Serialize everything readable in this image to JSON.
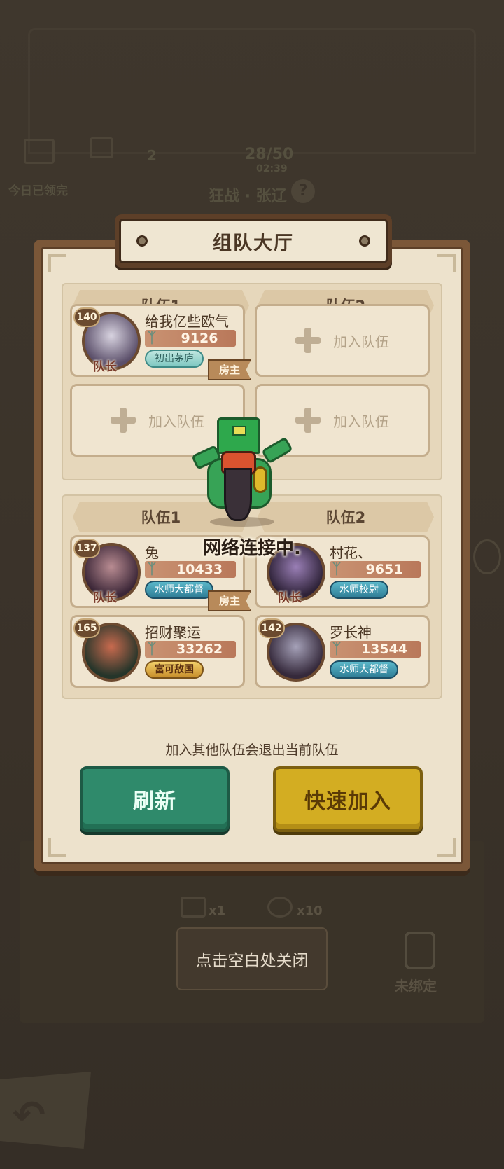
{
  "background": {
    "claimed_label": "今日已领完",
    "count_value": "2",
    "progress": "28/50",
    "timer": "02:39",
    "battle_label": "狂战 · 张辽",
    "help_icon": "question-icon",
    "item_counts": [
      "x1",
      "x10"
    ],
    "unbound_label": "未绑定"
  },
  "lobby": {
    "title": "组队大厅",
    "rooms": [
      {
        "teams": [
          {
            "header": "队伍1",
            "slots": [
              {
                "level": "140",
                "name": "给我亿些欧气",
                "power": "9126",
                "badge": "初出茅庐",
                "leader": "队长",
                "host": "房主"
              },
              {
                "empty_label": "加入队伍"
              }
            ]
          },
          {
            "header": "队伍2",
            "slots": [
              {
                "empty_label": "加入队伍"
              },
              {
                "empty_label": "加入队伍"
              }
            ]
          }
        ]
      },
      {
        "teams": [
          {
            "header": "队伍1",
            "slots": [
              {
                "level": "137",
                "name": "兔",
                "power": "10433",
                "badge": "水师大都督",
                "leader": "队长",
                "host": "房主"
              },
              {
                "level": "165",
                "name": "招财聚运",
                "power": "33262",
                "badge": "富可敌国"
              }
            ]
          },
          {
            "header": "队伍2",
            "slots": [
              {
                "level": "",
                "name": "村花、",
                "power": "9651",
                "badge": "水师校尉",
                "leader": "队长"
              },
              {
                "level": "142",
                "name": "罗长神",
                "power": "13544",
                "badge": "水师大都督"
              }
            ]
          }
        ]
      }
    ],
    "notice": "加入其他队伍会退出当前队伍",
    "refresh_label": "刷新",
    "quick_join_label": "快速加入"
  },
  "loading_text": "网络连接中.",
  "close_hint": "点击空白处关闭",
  "colors": {
    "panel_border": "#7b5738",
    "panel_fill": "#ede2cc",
    "refresh_green": "#2f8a6b",
    "quick_gold": "#d3ad22"
  }
}
